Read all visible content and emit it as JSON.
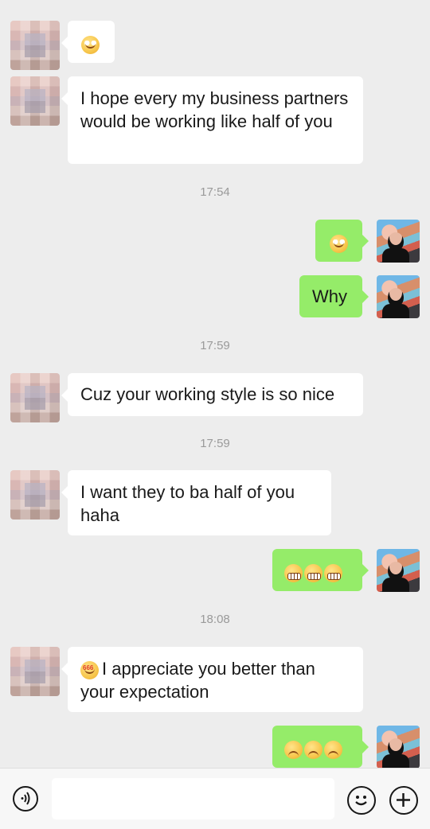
{
  "messages": [
    {
      "side": "left",
      "emoji": "emoji-1"
    },
    {
      "side": "left",
      "text": "I hope every my business partners would be working like half of you"
    },
    {
      "time": "17:54"
    },
    {
      "side": "right",
      "emoji": "emoji-2"
    },
    {
      "side": "right",
      "text": "Why"
    },
    {
      "time": "17:59"
    },
    {
      "side": "left",
      "text": "Cuz your working style is so nice"
    },
    {
      "time": "17:59"
    },
    {
      "side": "left",
      "text": "I want they to ba half of you haha"
    },
    {
      "side": "right",
      "emoji": "emoji-3"
    },
    {
      "time": "18:08"
    },
    {
      "side": "left",
      "text": "I appreciate you better than your expectation"
    },
    {
      "side": "right",
      "emoji": "emoji-4"
    }
  ],
  "input_bar": {
    "voice_icon": "voice-icon",
    "emoji_icon": "emoji-icon",
    "add_icon": "add-icon",
    "text": ""
  }
}
